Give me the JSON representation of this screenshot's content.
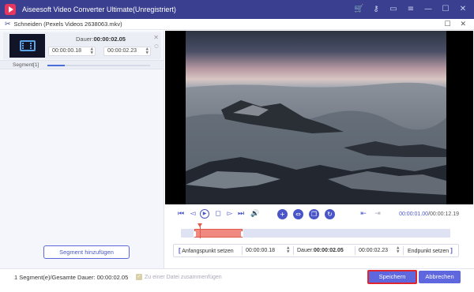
{
  "window": {
    "title": "Aiseesoft Video Converter Ultimate(Unregistriert)",
    "icons": [
      "cart-icon",
      "key-icon",
      "feedback-icon",
      "menu-icon",
      "minimize-icon",
      "maximize-icon",
      "close-icon"
    ]
  },
  "dialog": {
    "title": "Schneiden (Pexels Videos 2638063.mkv)"
  },
  "segment_card": {
    "dauer_label": "Dauer:",
    "dauer_value": "00:00:02.05",
    "start_value": "00:00:00.18",
    "end_value": "00:00:02.23"
  },
  "segment_list": {
    "label": "Segment[1]",
    "progress_fraction": 0.17
  },
  "left_panel": {
    "add_segment_label": "Segment hinzufügen"
  },
  "player": {
    "current_time": "00:00:01.00",
    "separator": "/",
    "total_time": "00:00:12.19",
    "accent": "#4a56c8"
  },
  "timeline": {
    "selection_start_fraction": 0.05,
    "selection_end_fraction": 0.23,
    "playhead_fraction": 0.07,
    "selection_color": "#f08a80"
  },
  "time_row": {
    "start_button": "Anfangspunkt setzen",
    "start_value": "00:00:00.18",
    "dauer_label": "Dauer:",
    "dauer_value": "00:00:02.05",
    "end_value": "00:00:02.23",
    "end_button": "Endpunkt setzen"
  },
  "footer": {
    "info": "1 Segment(e)/Gesamte Dauer: 00:00:02.05",
    "merge_label": "Zu einer Datei zusammenfügen",
    "save_label": "Speichern",
    "cancel_label": "Abbrechen"
  }
}
